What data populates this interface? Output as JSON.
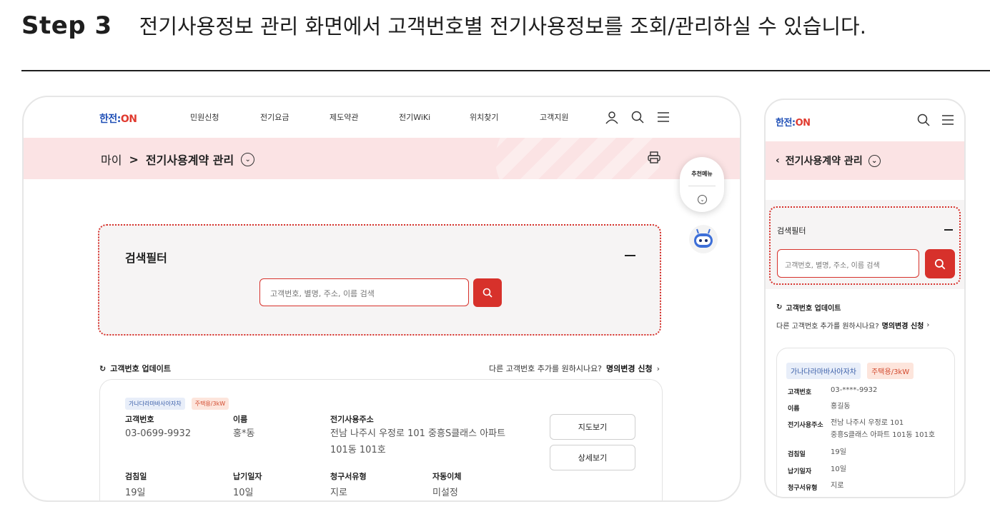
{
  "step": {
    "label": "Step 3",
    "description": "전기사용정보 관리 화면에서 고객번호별 전기사용정보를 조회/관리하실 수 있습니다."
  },
  "brand": {
    "logo_main": "한전:",
    "logo_on": "ON",
    "primary_color": "#d7312b",
    "logo_color": "#1f4fb6",
    "banner_color": "#fbe3e4"
  },
  "desktop": {
    "nav": {
      "items": [
        "민원신청",
        "전기요금",
        "제도약관",
        "전기WiKi",
        "위치찾기",
        "고객지원"
      ],
      "icons": [
        "user-icon",
        "search-icon",
        "menu-icon"
      ]
    },
    "breadcrumb": {
      "parent": "마이",
      "separator": ">",
      "current": "전기사용계약 관리"
    },
    "filter": {
      "title": "검색필터",
      "placeholder": "고객번호, 별명, 주소, 이름 검색"
    },
    "update_label": "고객번호 업데이트",
    "request_text": "다른 고객번호 추가를 원하시나요?",
    "request_link": "명의변경 신청",
    "card": {
      "tags": [
        "가나다라마바사아자차",
        "주택용/3kW"
      ],
      "labels": {
        "customer_no": "고객번호",
        "name": "이름",
        "address": "전기사용주소",
        "meter_day": "검침일",
        "due_day": "납기일자",
        "bill_type": "청구서유형",
        "auto_pay": "자동이체"
      },
      "values": {
        "customer_no": "03-0699-9932",
        "name": "홍*동",
        "address_line1": "전남 나주시 우정로 101 중흥S클래스 아파트",
        "address_line2": "101동 101호",
        "meter_day": "19일",
        "due_day": "10일",
        "bill_type": "지로",
        "auto_pay": "미설정"
      },
      "buttons": {
        "map": "지도보기",
        "detail": "상세보기"
      }
    },
    "recommend_menu": "추천메뉴"
  },
  "mobile": {
    "breadcrumb": "전기사용계약 관리",
    "filter": {
      "title": "검색필터",
      "placeholder": "고객번호, 별명, 주소, 이름 검색"
    },
    "update_label": "고객번호 업데이트",
    "request_text": "다른 고객번호 추가를 원하시나요?",
    "request_link": "명의변경 신청",
    "card": {
      "tags": [
        "가나다라마바사아자차",
        "주택용/3kW"
      ],
      "labels": {
        "customer_no": "고객번호",
        "name": "이름",
        "address": "전기사용주소",
        "meter_day": "검침일",
        "due_day": "납기일자",
        "bill_type": "청구서유형"
      },
      "values": {
        "customer_no": "03-****-9932",
        "name": "홍길동",
        "address_line1": "전남 나주시 우정로 101",
        "address_line2": "중흥S클래스 아파트 101동 101호",
        "meter_day": "19일",
        "due_day": "10일",
        "bill_type": "지로"
      }
    }
  }
}
